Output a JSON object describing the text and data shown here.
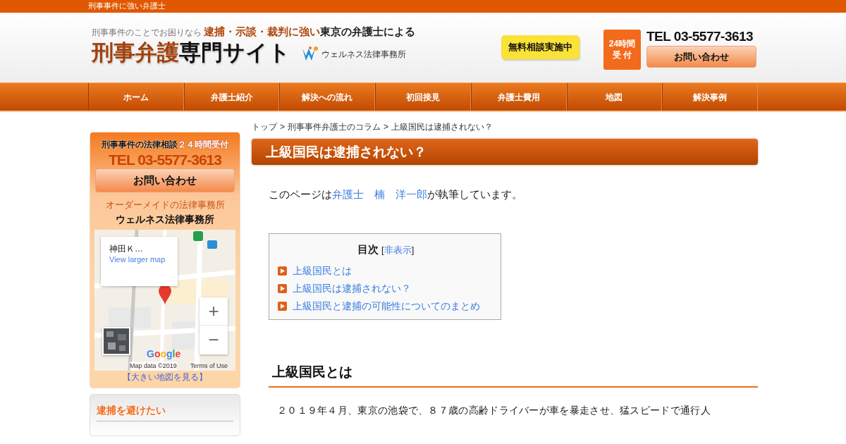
{
  "top_bar": {
    "text": "刑事事件に強い弁護士"
  },
  "header": {
    "tagline_lead": "刑事事件のことでお困りなら",
    "tagline_emphasis": "逮捕・示談・裁判に強い",
    "tagline_tail": "東京の弁護士による",
    "site_title_accent": "刑事弁護",
    "site_title_rest": "専門サイト",
    "firm_name": "ウェルネス法律事務所",
    "free_consult": "無料相談実施中",
    "hours_badge": [
      "24時間",
      "受 付"
    ],
    "phone": "TEL 03-5577-3613",
    "contact_button": "お問い合わせ"
  },
  "nav": [
    {
      "label": "ホーム"
    },
    {
      "label": "弁護士紹介"
    },
    {
      "label": "解決への流れ"
    },
    {
      "label": "初回接見"
    },
    {
      "label": "弁護士費用"
    },
    {
      "label": "地図"
    },
    {
      "label": "解決事例"
    }
  ],
  "breadcrumb": {
    "separator": ">",
    "items": [
      "トップ",
      "刑事事件弁護士のコラム",
      "上級国民は逮捕されない？"
    ]
  },
  "sidebar": {
    "consult_title": "刑事事件の法律相談",
    "consult_hours": "２４時間受付",
    "phone": "TEL 03-5577-3613",
    "contact_button": "お問い合わせ",
    "tagline": "オーダーメイドの法律事務所",
    "firm_name": "ウェルネス法律事務所",
    "map": {
      "kind": "picture",
      "info_title": "神田Ｋ…",
      "info_link": "View larger map",
      "zoom_in": "+",
      "zoom_out": "−",
      "logo": "Google",
      "attribution": "Map data ©2019",
      "terms": "Terms of Use"
    },
    "map_link": "【大きい地図を見る】",
    "section_title": "逮捕を避けたい"
  },
  "article": {
    "title": "上級国民は逮捕されない？",
    "byline_before": "このページは",
    "byline_link": "弁護士　楠　洋一郎",
    "byline_after": "が執筆しています。",
    "toc": {
      "title": "目次",
      "toggle_before": "[",
      "toggle": "非表示",
      "toggle_after": "]",
      "items": [
        "上級国民とは",
        "上級国民は逮捕されない？",
        "上級国民と逮捕の可能性についてのまとめ"
      ]
    },
    "sections": [
      {
        "heading": "上級国民とは",
        "paragraph": "２０１９年４月、東京の池袋で、８７歳の高齢ドライバーが車を暴走させ、猛スピードで通行人"
      }
    ]
  }
}
